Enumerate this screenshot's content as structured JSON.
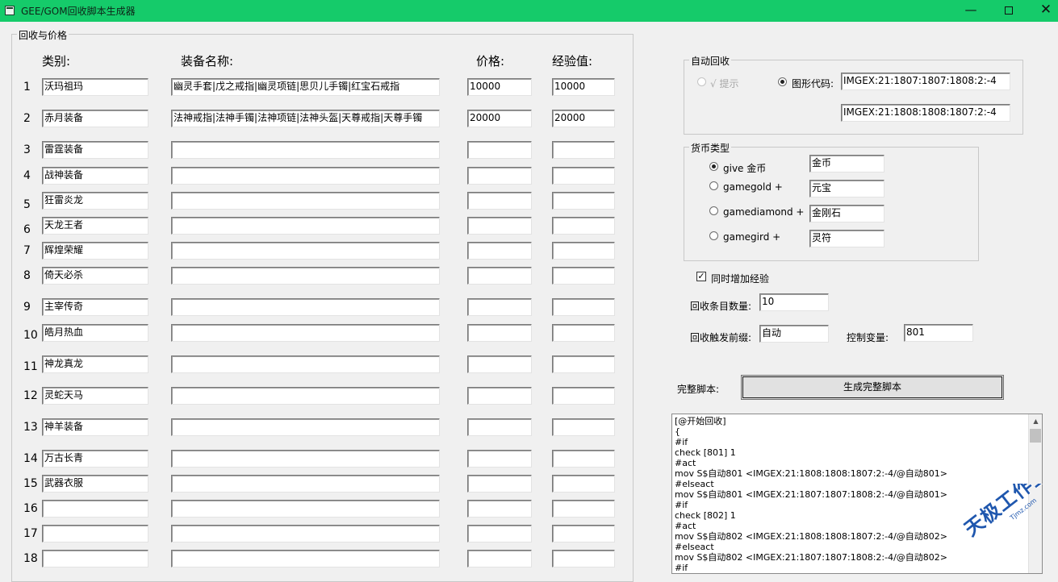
{
  "window": {
    "title": "GEE/GOM回收脚本生成器",
    "minimize": "—",
    "close": "✕"
  },
  "recycle_group": {
    "legend": "回收与价格",
    "headers": {
      "category": "类别:",
      "name": "装备名称:",
      "price": "价格:",
      "exp": "经验值:"
    },
    "rows": [
      {
        "num": "1",
        "category": "沃玛祖玛",
        "name": "幽灵手套|戊之戒指|幽灵项链|思贝儿手镯|红宝石戒指",
        "price": "10000",
        "exp": "10000"
      },
      {
        "num": "2",
        "category": "赤月装备",
        "name": "法神戒指|法神手镯|法神项链|法神头盔|天尊戒指|天尊手镯",
        "price": "20000",
        "exp": "20000"
      },
      {
        "num": "3",
        "category": "雷霆装备",
        "name": "",
        "price": "",
        "exp": ""
      },
      {
        "num": "4",
        "category": "战神装备",
        "name": "",
        "price": "",
        "exp": ""
      },
      {
        "num": "5",
        "category": "狂雷炎龙",
        "name": "",
        "price": "",
        "exp": ""
      },
      {
        "num": "6",
        "category": "天龙王者",
        "name": "",
        "price": "",
        "exp": ""
      },
      {
        "num": "7",
        "category": "辉煌荣耀",
        "name": "",
        "price": "",
        "exp": ""
      },
      {
        "num": "8",
        "category": "倚天必杀",
        "name": "",
        "price": "",
        "exp": ""
      },
      {
        "num": "9",
        "category": "主宰传奇",
        "name": "",
        "price": "",
        "exp": ""
      },
      {
        "num": "10",
        "category": "皓月热血",
        "name": "",
        "price": "",
        "exp": ""
      },
      {
        "num": "11",
        "category": "神龙真龙",
        "name": "",
        "price": "",
        "exp": ""
      },
      {
        "num": "12",
        "category": "灵蛇天马",
        "name": "",
        "price": "",
        "exp": ""
      },
      {
        "num": "13",
        "category": "神羊装备",
        "name": "",
        "price": "",
        "exp": ""
      },
      {
        "num": "14",
        "category": "万古长青",
        "name": "",
        "price": "",
        "exp": ""
      },
      {
        "num": "15",
        "category": "武器衣服",
        "name": "",
        "price": "",
        "exp": ""
      },
      {
        "num": "16",
        "category": "",
        "name": "",
        "price": "",
        "exp": ""
      },
      {
        "num": "17",
        "category": "",
        "name": "",
        "price": "",
        "exp": ""
      },
      {
        "num": "18",
        "category": "",
        "name": "",
        "price": "",
        "exp": ""
      }
    ]
  },
  "auto_recycle": {
    "legend": "自动回收",
    "hint_option": "√ 提示",
    "image_option": "图形代码:",
    "image_code_1": "IMGEX:21:1807:1807:1808:2:-4",
    "image_code_2": "IMGEX:21:1808:1808:1807:2:-4"
  },
  "currency": {
    "legend": "货币类型",
    "options": [
      {
        "label": "give 金币",
        "value": "金币",
        "selected": true
      },
      {
        "label": "gamegold +",
        "value": "元宝",
        "selected": false
      },
      {
        "label": "gamediamond +",
        "value": "金刚石",
        "selected": false
      },
      {
        "label": "gamegird +",
        "value": "灵符",
        "selected": false
      }
    ]
  },
  "settings": {
    "add_exp_label": "同时增加经验",
    "add_exp_checked": true,
    "check_mark": "✓",
    "count_label": "回收条目数量:",
    "count_value": "10",
    "prefix_label": "回收触发前缀:",
    "prefix_value": "自动",
    "var_label": "控制变量:",
    "var_value": "801"
  },
  "script": {
    "label": "完整脚本:",
    "generate_button": "生成完整脚本",
    "lines": [
      "[@开始回收]",
      "{",
      "#if",
      "check [801] 1",
      "#act",
      "mov S$自动801 <IMGEX:21:1808:1808:1807:2:-4/@自动801>",
      "#elseact",
      "mov S$自动801 <IMGEX:21:1807:1807:1808:2:-4/@自动801>",
      "#if",
      "check [802] 1",
      "#act",
      "mov S$自动802 <IMGEX:21:1808:1808:1807:2:-4/@自动802>",
      "#elseact",
      "mov S$自动802 <IMGEX:21:1807:1807:1808:2:-4/@自动802>",
      "#if"
    ],
    "scroll_up": "▲"
  },
  "watermark": {
    "main": "天极工作室",
    "sub": "Tjmz.com"
  }
}
